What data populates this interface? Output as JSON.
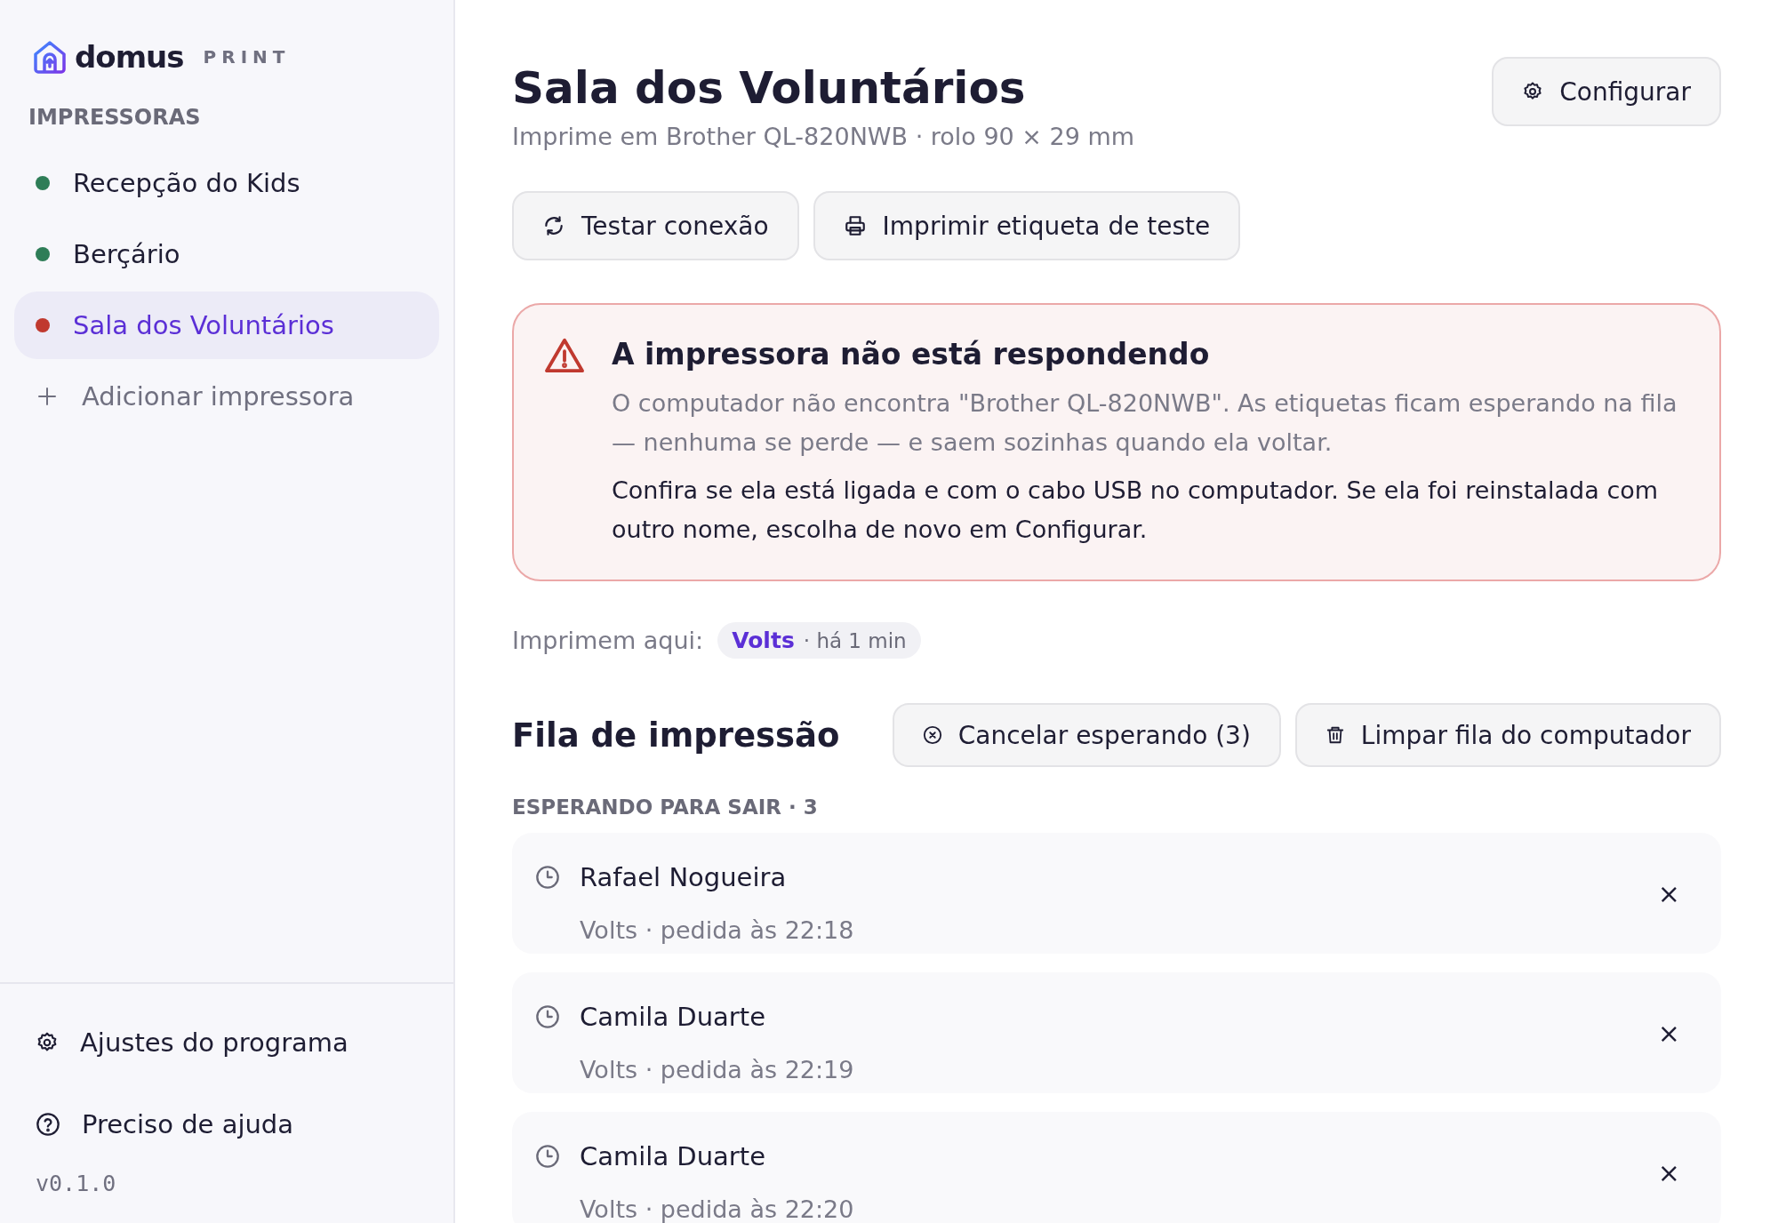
{
  "brand": {
    "name": "domus",
    "suffix": "PRINT"
  },
  "sidebar": {
    "section_title": "IMPRESSORAS",
    "printers": [
      {
        "name": "Recepção do Kids",
        "color": "#2e7d57",
        "selected": false
      },
      {
        "name": "Berçário",
        "color": "#2e7d57",
        "selected": false
      },
      {
        "name": "Sala dos Voluntários",
        "color": "#c0392f",
        "selected": true
      }
    ],
    "add_label": "Adicionar impressora",
    "footer_items": [
      {
        "kind": "settings",
        "label": "Ajustes do programa"
      },
      {
        "kind": "help",
        "label": "Preciso de ajuda"
      }
    ],
    "version": "v0.1.0"
  },
  "header": {
    "title": "Sala dos Voluntários",
    "subtitle": "Imprime em Brother QL-820NWB · rolo 90 × 29 mm",
    "configure_label": "Configurar"
  },
  "actions": [
    {
      "kind": "refresh",
      "label": "Testar conexão"
    },
    {
      "kind": "printer",
      "label": "Imprimir etiqueta de teste"
    }
  ],
  "alert": {
    "title": "A impressora não está respondendo",
    "body": "O computador não encontra \"Brother QL-820NWB\". As etiquetas ficam esperando na fila — nenhuma se perde — e saem sozinhas quando ela voltar.",
    "hint": "Confira se ela está ligada e com o cabo USB no computador. Se ela foi reinstalada com outro nome, escolha de novo em Configurar."
  },
  "printing_here": {
    "label": "Imprimem aqui:",
    "source": "Volts",
    "time": "· há 1 min"
  },
  "queue": {
    "title": "Fila de impressão",
    "buttons": [
      {
        "kind": "cancel",
        "label": "Cancelar esperando (3)"
      },
      {
        "kind": "trash",
        "label": "Limpar fila do computador"
      }
    ],
    "section_title": "ESPERANDO PARA SAIR · 3",
    "jobs": [
      {
        "name": "Rafael Nogueira",
        "detail": "Volts · pedida às 22:18",
        "remove": "×"
      },
      {
        "name": "Camila Duarte",
        "detail": "Volts · pedida às 22:19",
        "remove": "×"
      },
      {
        "name": "Camila Duarte",
        "detail": "Volts · pedida às 22:20",
        "remove": "×"
      }
    ]
  }
}
